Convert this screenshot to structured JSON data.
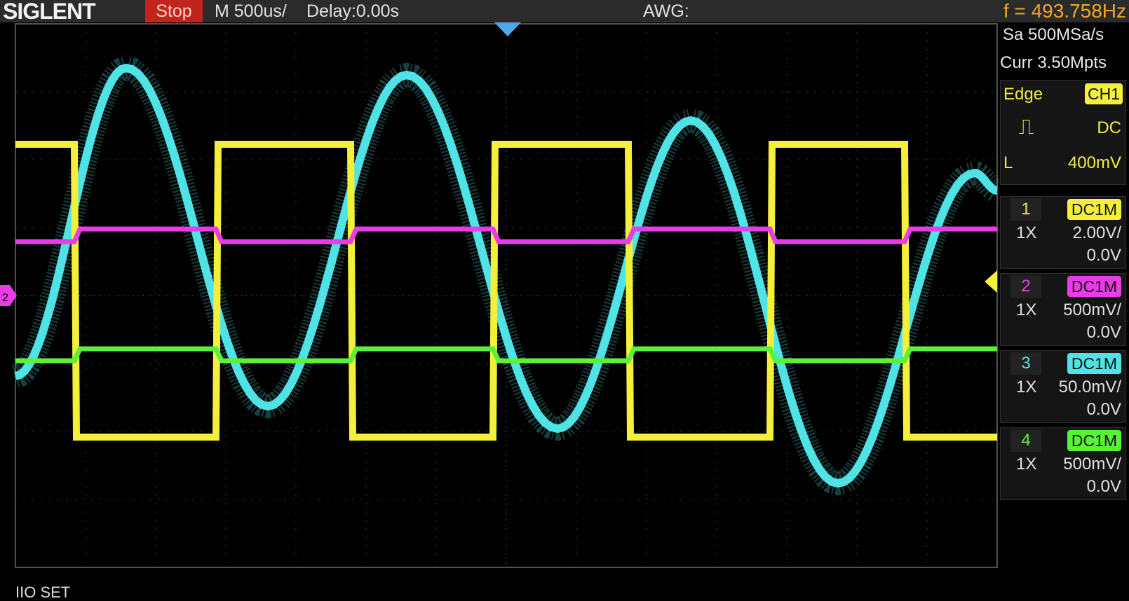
{
  "topbar": {
    "brand": "SIGLENT",
    "run_state": "Stop",
    "timebase": "M 500us/",
    "delay": "Delay:0.00s",
    "awg": "AWG:",
    "frequency": "f = 493.758Hz"
  },
  "acquisition": {
    "sample_rate": "Sa 500MSa/s",
    "memory_depth": "Curr 3.50Mpts"
  },
  "trigger": {
    "type": "Edge",
    "source": "CH1",
    "coupling": "DC",
    "level_label": "L",
    "level": "400mV"
  },
  "channels": [
    {
      "number": "1",
      "coupling": "DC1M",
      "probe": "1X",
      "scale": "2.00V/",
      "offset": "0.0V",
      "color": "#f3ef3a"
    },
    {
      "number": "2",
      "coupling": "DC1M",
      "probe": "1X",
      "scale": "500mV/",
      "offset": "0.0V",
      "color": "#ea3be8"
    },
    {
      "number": "3",
      "coupling": "DC1M",
      "probe": "1X",
      "scale": "50.0mV/",
      "offset": "0.0V",
      "color": "#4fe3e6"
    },
    {
      "number": "4",
      "coupling": "DC1M",
      "probe": "1X",
      "scale": "500mV/",
      "offset": "0.0V",
      "color": "#5af238"
    }
  ],
  "markers": {
    "ch2_marker": "2"
  },
  "bottom_text": "IIO SET",
  "colors": {
    "grid": "#3a3a3a",
    "trigger_marker": "#4da8e8",
    "level_marker": "#f3ef3a"
  }
}
